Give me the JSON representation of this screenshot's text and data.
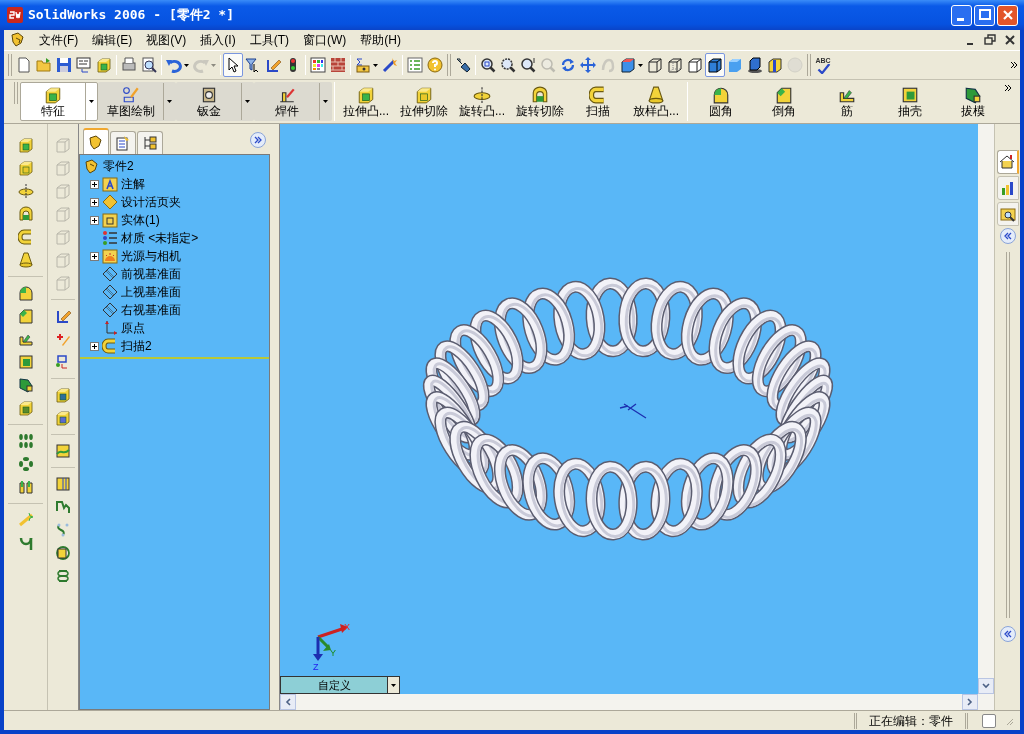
{
  "window": {
    "title": "SolidWorks 2006 - [零件2 *]"
  },
  "menu": [
    "文件(F)",
    "编辑(E)",
    "视图(V)",
    "插入(I)",
    "工具(T)",
    "窗口(W)",
    "帮助(H)"
  ],
  "toolbar": [
    {
      "kind": "new",
      "pressed": false,
      "disabled": false
    },
    {
      "kind": "open",
      "pressed": false,
      "disabled": false
    },
    {
      "kind": "save",
      "pressed": false,
      "disabled": false
    },
    {
      "kind": "make-drawing",
      "pressed": false,
      "disabled": false
    },
    {
      "kind": "make-assembly",
      "pressed": false,
      "disabled": false
    },
    {
      "kind": "separator"
    },
    {
      "kind": "print",
      "pressed": false,
      "disabled": false
    },
    {
      "kind": "print-preview",
      "pressed": false,
      "disabled": false
    },
    {
      "kind": "separator"
    },
    {
      "kind": "undo",
      "pressed": false,
      "disabled": false
    },
    {
      "kind": "redo",
      "pressed": false,
      "disabled": true
    },
    {
      "kind": "separator"
    },
    {
      "kind": "select",
      "pressed": true,
      "disabled": false
    },
    {
      "kind": "select-filter",
      "pressed": false,
      "disabled": false
    },
    {
      "kind": "edit-sketch",
      "pressed": false,
      "disabled": false
    },
    {
      "kind": "rebuild",
      "pressed": false,
      "disabled": false
    },
    {
      "kind": "separator"
    },
    {
      "kind": "color-grid",
      "pressed": false,
      "disabled": false
    },
    {
      "kind": "texture",
      "pressed": false,
      "disabled": false
    },
    {
      "kind": "separator"
    },
    {
      "kind": "equations",
      "pressed": false,
      "disabled": false
    },
    {
      "kind": "feature-tool",
      "pressed": false,
      "disabled": false
    },
    {
      "kind": "separator"
    },
    {
      "kind": "properties",
      "pressed": false,
      "disabled": false
    },
    {
      "kind": "help",
      "pressed": false,
      "disabled": false
    },
    {
      "kind": "grip"
    },
    {
      "kind": "previous-view",
      "pressed": false,
      "disabled": false
    },
    {
      "kind": "separator"
    },
    {
      "kind": "zoom-fit",
      "pressed": false,
      "disabled": false
    },
    {
      "kind": "zoom-area",
      "pressed": false,
      "disabled": false
    },
    {
      "kind": "zoom-in-out",
      "pressed": false,
      "disabled": false
    },
    {
      "kind": "zoom-selection",
      "pressed": false,
      "disabled": true
    },
    {
      "kind": "rotate",
      "pressed": false,
      "disabled": false
    },
    {
      "kind": "pan",
      "pressed": false,
      "disabled": false
    },
    {
      "kind": "roll",
      "pressed": false,
      "disabled": true
    },
    {
      "kind": "view-orientation",
      "pressed": false,
      "disabled": false
    },
    {
      "kind": "wireframe",
      "pressed": false,
      "disabled": false
    },
    {
      "kind": "hidden-lines",
      "pressed": false,
      "disabled": false
    },
    {
      "kind": "hidden-removed",
      "pressed": false,
      "disabled": false
    },
    {
      "kind": "shaded-edges",
      "pressed": true,
      "disabled": false
    },
    {
      "kind": "shaded",
      "pressed": false,
      "disabled": false
    },
    {
      "kind": "shadows",
      "pressed": false,
      "disabled": false
    },
    {
      "kind": "section",
      "pressed": false,
      "disabled": false
    },
    {
      "kind": "realview",
      "pressed": false,
      "disabled": true
    },
    {
      "kind": "grip"
    },
    {
      "kind": "spelling"
    }
  ],
  "spelling_label": "ABC",
  "command_tabs": [
    {
      "label": "特征",
      "selected": true
    },
    {
      "label": "草图绘制",
      "selected": false
    },
    {
      "label": "钣金",
      "selected": false
    },
    {
      "label": "焊件",
      "selected": false
    }
  ],
  "command_buttons": [
    {
      "label": "拉伸凸..."
    },
    {
      "label": "拉伸切除"
    },
    {
      "label": "旋转凸..."
    },
    {
      "label": "旋转切除"
    },
    {
      "label": "扫描"
    },
    {
      "label": "放样凸..."
    },
    {
      "label": "圆角"
    },
    {
      "label": "倒角"
    },
    {
      "label": "筋"
    },
    {
      "label": "抽壳"
    },
    {
      "label": "拔模"
    }
  ],
  "manager_tabs": [
    {
      "kind": "feature-tree",
      "selected": true
    },
    {
      "kind": "properties",
      "selected": false
    },
    {
      "kind": "configurations",
      "selected": false
    }
  ],
  "feature_tree": {
    "label": "零件2",
    "children": [
      {
        "label": "注解",
        "kind": "annotations",
        "expanded": false
      },
      {
        "label": "设计活页夹",
        "kind": "binder",
        "expanded": false
      },
      {
        "label": "实体(1)",
        "kind": "bodies",
        "expanded": false
      },
      {
        "label": "材质 <未指定>",
        "kind": "material"
      },
      {
        "label": "光源与相机",
        "kind": "lights",
        "expanded": false
      },
      {
        "label": "前视基准面",
        "kind": "plane"
      },
      {
        "label": "上视基准面",
        "kind": "plane"
      },
      {
        "label": "右视基准面",
        "kind": "plane"
      },
      {
        "label": "原点",
        "kind": "origin"
      },
      {
        "label": "扫描2",
        "kind": "sweep",
        "expanded": false
      }
    ]
  },
  "viewport": {
    "view_orientation": "自定义",
    "triad_labels": [
      "X",
      "Y",
      "Z"
    ]
  },
  "task_pane": [
    {
      "kind": "home",
      "selected": true
    },
    {
      "kind": "resources",
      "selected": false
    },
    {
      "kind": "explorer",
      "selected": false
    }
  ],
  "status_bar": {
    "text": "正在编辑：零件"
  }
}
